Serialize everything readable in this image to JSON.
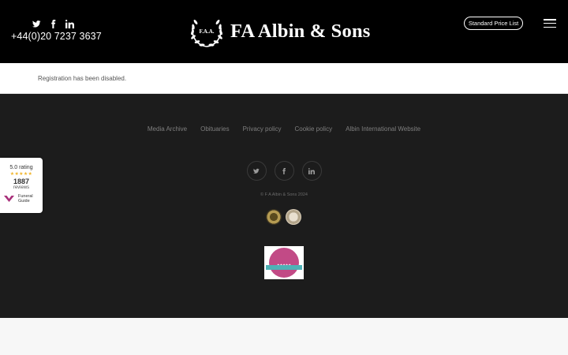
{
  "header": {
    "social_icons": [
      "twitter-icon",
      "facebook-icon",
      "linkedin-icon"
    ],
    "phone": "+44(0)20 7237 3637",
    "logo_monogram": "F.A.A.",
    "logo_text": "FA Albin & Sons",
    "price_list_button": "Standard Price List",
    "menu_icon": "hamburger-menu-icon"
  },
  "notice": {
    "text": "Registration has been disabled."
  },
  "footer": {
    "links": [
      "Media Archive",
      "Obituaries",
      "Privacy policy",
      "Cookie policy",
      "Albin International Website"
    ],
    "social_icons": [
      "twitter-icon",
      "facebook-icon",
      "linkedin-icon"
    ],
    "copyright": "© F A Albin & Sons 2024"
  },
  "rating_widget": {
    "rating": "5.0 rating",
    "stars": 5,
    "count": "1887",
    "reviews_label": "reviews",
    "brand_line1": "Funeral",
    "brand_line2": "Guide"
  },
  "colors": {
    "header_bg": "#000000",
    "footer_bg": "#1c1c1c",
    "star": "#f0b42a",
    "award_pink": "#c24a86",
    "award_teal": "#4fb1b6"
  }
}
